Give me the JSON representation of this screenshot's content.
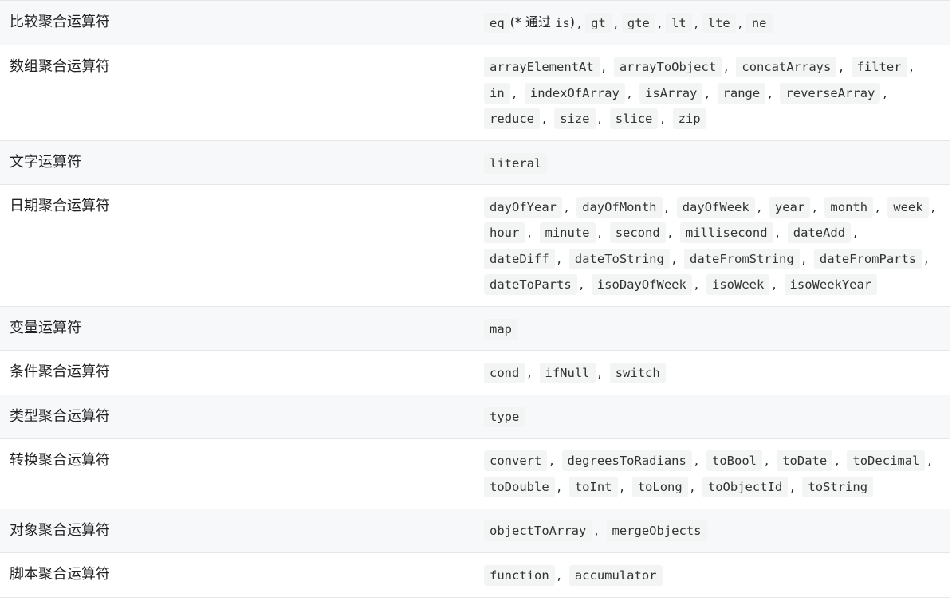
{
  "rows": [
    {
      "category": "比较聚合运算符",
      "ops": [
        "eq",
        "gt",
        "gte",
        "lt",
        "lte",
        "ne"
      ],
      "eq_note_prefix": "(* 通过 ",
      "eq_note_code": "is",
      "eq_note_suffix": ")"
    },
    {
      "category": "数组聚合运算符",
      "ops": [
        "arrayElementAt",
        "arrayToObject",
        "concatArrays",
        "filter",
        "in",
        "indexOfArray",
        "isArray",
        "range",
        "reverseArray",
        "reduce",
        "size",
        "slice",
        "zip"
      ]
    },
    {
      "category": "文字运算符",
      "ops": [
        "literal"
      ]
    },
    {
      "category": "日期聚合运算符",
      "ops": [
        "dayOfYear",
        "dayOfMonth",
        "dayOfWeek",
        "year",
        "month",
        "week",
        "hour",
        "minute",
        "second",
        "millisecond",
        "dateAdd",
        "dateDiff",
        "dateToString",
        "dateFromString",
        "dateFromParts",
        "dateToParts",
        "isoDayOfWeek",
        "isoWeek",
        "isoWeekYear"
      ]
    },
    {
      "category": "变量运算符",
      "ops": [
        "map"
      ]
    },
    {
      "category": "条件聚合运算符",
      "ops": [
        "cond",
        "ifNull",
        "switch"
      ]
    },
    {
      "category": "类型聚合运算符",
      "ops": [
        "type"
      ]
    },
    {
      "category": "转换聚合运算符",
      "ops": [
        "convert",
        "degreesToRadians",
        "toBool",
        "toDate",
        "toDecimal",
        "toDouble",
        "toInt",
        "toLong",
        "toObjectId",
        "toString"
      ]
    },
    {
      "category": "对象聚合运算符",
      "ops": [
        "objectToArray",
        "mergeObjects"
      ]
    },
    {
      "category": "脚本聚合运算符",
      "ops": [
        "function",
        "accumulator"
      ]
    }
  ],
  "separator": ","
}
